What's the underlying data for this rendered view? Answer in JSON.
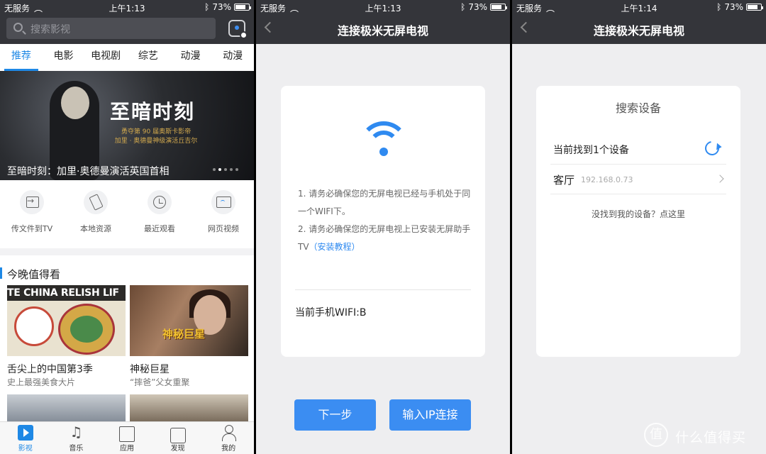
{
  "panel1": {
    "status": {
      "carrier": "无服务",
      "time": "上午1:13",
      "battery": "73%"
    },
    "search_placeholder": "搜索影视",
    "tabs": [
      "推荐",
      "电影",
      "电视剧",
      "综艺",
      "动漫",
      "动漫"
    ],
    "banner": {
      "poster_title": "至暗时刻",
      "poster_sub1": "勇夺第 90 届奥斯卡影帝",
      "poster_sub2": "加里 · 奥德曼神级演活丘吉尔",
      "caption": "至暗时刻：加里·奥德曼演活英国首相"
    },
    "shortcuts": [
      "传文件到TV",
      "本地资源",
      "最近观看",
      "网页视频"
    ],
    "section_title": "今晚值得看",
    "items": [
      {
        "strip": "TE CHINA RELISH LIF",
        "title": "舌尖上的中国第3季",
        "sub": "史上最强美食大片"
      },
      {
        "badge": "神秘巨星",
        "title": "神秘巨星",
        "sub": "“摔爸”父女重聚"
      }
    ],
    "bottom_nav": [
      "影视",
      "音乐",
      "应用",
      "发现",
      "我的"
    ]
  },
  "panel2": {
    "status": {
      "carrier": "无服务",
      "time": "上午1:13",
      "battery": "73%"
    },
    "title": "连接极米无屏电视",
    "tip1": "1. 请务必确保您的无屏电视已经与手机处于同一个WIFI下。",
    "tip2": "2. 请务必确保您的无屏电视上已安装无屏助手TV",
    "tip2_link": "（安装教程）",
    "wifi_current": "当前手机WIFI:B",
    "btn_next": "下一步",
    "btn_ip": "输入IP连接"
  },
  "panel3": {
    "status": {
      "carrier": "无服务",
      "time": "上午1:14",
      "battery": "73%"
    },
    "title": "连接极米无屏电视",
    "card_title": "搜索设备",
    "found": "当前找到1个设备",
    "device_name": "客厅",
    "device_ip": "192.168.0.73",
    "not_found": "没找到我的设备？点这里"
  },
  "watermark": {
    "logo": "值",
    "text": "什么值得买"
  }
}
